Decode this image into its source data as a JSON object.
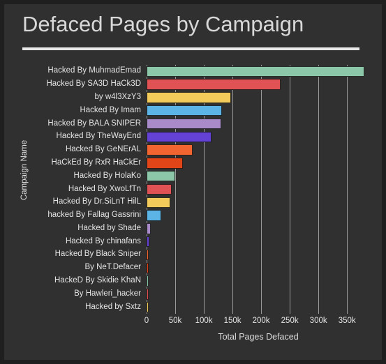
{
  "chart_data": {
    "type": "bar",
    "orientation": "horizontal",
    "title": "Defaced Pages by Campaign",
    "xlabel": "Total Pages Defaced",
    "ylabel": "Campaign Name",
    "xlim": [
      0,
      390000
    ],
    "grid": true,
    "legend": false,
    "xticks": [
      {
        "value": 0,
        "label": "0"
      },
      {
        "value": 50000,
        "label": "50k"
      },
      {
        "value": 100000,
        "label": "100k"
      },
      {
        "value": 150000,
        "label": "150k"
      },
      {
        "value": 200000,
        "label": "200k"
      },
      {
        "value": 250000,
        "label": "250k"
      },
      {
        "value": 300000,
        "label": "300k"
      },
      {
        "value": 350000,
        "label": "350k"
      }
    ],
    "categories": [
      "Hacked By MuhmadEmad",
      "Hacked By SA3D HaCk3D",
      "by w4l3XzY3",
      "Hacked By Imam",
      "Hacked By BALA SNIPER",
      "Hacked By TheWayEnd",
      "Hacked By GeNErAL",
      "HaCkEd By RxR HaCkEr",
      "Hacked By HolaKo",
      "Hacked By XwoLfTn",
      "Hacked By Dr.SiLnT HilL",
      "hacked By Fallag Gassrini",
      "Hacked by Shade",
      "Hacked By chinafans",
      "Hacked By Black Sniper",
      "By NeT.Defacer",
      "HackeD By Skidie KhaN",
      "By Hawleri_hacker",
      "Hacked by Sxtz"
    ],
    "values": [
      380000,
      234000,
      147000,
      132000,
      130000,
      113000,
      80000,
      63000,
      50000,
      44000,
      42000,
      25000,
      7000,
      4500,
      3500,
      2800,
      2300,
      1800,
      1400
    ],
    "colors": [
      "#8BC7A8",
      "#E05253",
      "#F2CB5B",
      "#5BB4E5",
      "#A98BC9",
      "#6442D6",
      "#F26430",
      "#E24518",
      "#8BC7A8",
      "#E05253",
      "#F2CB5B",
      "#5BB4E5",
      "#A98BC9",
      "#6442D6",
      "#F26430",
      "#E24518",
      "#8BC7A8",
      "#E05253",
      "#F2CB5B"
    ]
  },
  "style": {
    "background": "#303030",
    "page_background": "#1f1f1f",
    "text_color": "#e4e4e4",
    "gridline_color": "#9a9a9a",
    "title_color": "#d8d8d8",
    "rule_color": "#e8e8e8"
  }
}
